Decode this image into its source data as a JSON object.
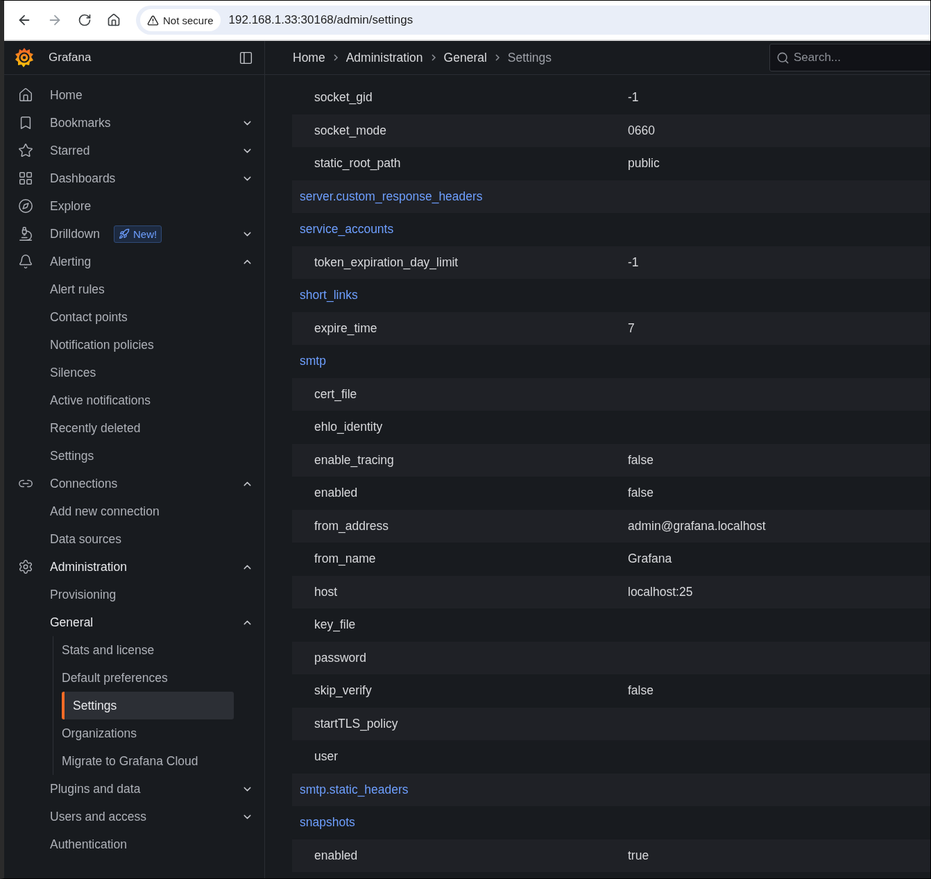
{
  "browser": {
    "security": "Not secure",
    "url": "192.168.1.33:30168/admin/settings"
  },
  "brand": "Grafana",
  "breadcrumbs": [
    "Home",
    "Administration",
    "General",
    "Settings"
  ],
  "search": {
    "placeholder": "Search..."
  },
  "sidebar": {
    "items": [
      {
        "label": "Home",
        "selected": false
      },
      {
        "label": "Bookmarks",
        "selected": false,
        "expanded": false
      },
      {
        "label": "Starred",
        "selected": false,
        "expanded": false
      },
      {
        "label": "Dashboards",
        "selected": false,
        "expanded": false
      },
      {
        "label": "Explore",
        "selected": false
      },
      {
        "label": "Drilldown",
        "selected": false,
        "expanded": false,
        "badge": "New!"
      },
      {
        "label": "Alerting",
        "selected": false,
        "expanded": true,
        "children": [
          {
            "label": "Alert rules",
            "selected": false
          },
          {
            "label": "Contact points",
            "selected": false
          },
          {
            "label": "Notification policies",
            "selected": false
          },
          {
            "label": "Silences",
            "selected": false
          },
          {
            "label": "Active notifications",
            "selected": false
          },
          {
            "label": "Recently deleted",
            "selected": false
          },
          {
            "label": "Settings",
            "selected": false
          }
        ]
      },
      {
        "label": "Connections",
        "selected": false,
        "expanded": true,
        "children": [
          {
            "label": "Add new connection",
            "selected": false
          },
          {
            "label": "Data sources",
            "selected": false
          }
        ]
      },
      {
        "label": "Administration",
        "selected": false,
        "expanded": true,
        "children": [
          {
            "label": "Provisioning",
            "selected": false
          },
          {
            "label": "General",
            "selected": false,
            "expanded": true,
            "children": [
              {
                "label": "Stats and license",
                "selected": false
              },
              {
                "label": "Default preferences",
                "selected": false
              },
              {
                "label": "Settings",
                "selected": true
              },
              {
                "label": "Organizations",
                "selected": false
              },
              {
                "label": "Migrate to Grafana Cloud",
                "selected": false
              }
            ]
          },
          {
            "label": "Plugins and data",
            "selected": false,
            "expanded": false
          },
          {
            "label": "Users and access",
            "selected": false,
            "expanded": false
          },
          {
            "label": "Authentication",
            "selected": false
          }
        ]
      }
    ]
  },
  "settings": {
    "rows": [
      {
        "kind": "setting",
        "name": "socket_gid",
        "value": "-1"
      },
      {
        "kind": "setting",
        "name": "socket_mode",
        "value": "0660"
      },
      {
        "kind": "setting",
        "name": "static_root_path",
        "value": "public"
      },
      {
        "kind": "section",
        "name": "server.custom_response_headers"
      },
      {
        "kind": "section",
        "name": "service_accounts"
      },
      {
        "kind": "setting",
        "name": "token_expiration_day_limit",
        "value": "-1"
      },
      {
        "kind": "section",
        "name": "short_links"
      },
      {
        "kind": "setting",
        "name": "expire_time",
        "value": "7"
      },
      {
        "kind": "section",
        "name": "smtp"
      },
      {
        "kind": "setting",
        "name": "cert_file"
      },
      {
        "kind": "setting",
        "name": "ehlo_identity"
      },
      {
        "kind": "setting",
        "name": "enable_tracing",
        "value": "false"
      },
      {
        "kind": "setting",
        "name": "enabled",
        "value": "false"
      },
      {
        "kind": "setting",
        "name": "from_address",
        "value": "admin@grafana.localhost"
      },
      {
        "kind": "setting",
        "name": "from_name",
        "value": "Grafana"
      },
      {
        "kind": "setting",
        "name": "host",
        "value": "localhost:25"
      },
      {
        "kind": "setting",
        "name": "key_file"
      },
      {
        "kind": "setting",
        "name": "password"
      },
      {
        "kind": "setting",
        "name": "skip_verify",
        "value": "false"
      },
      {
        "kind": "setting",
        "name": "startTLS_policy"
      },
      {
        "kind": "setting",
        "name": "user"
      },
      {
        "kind": "section",
        "name": "smtp.static_headers"
      },
      {
        "kind": "section",
        "name": "snapshots"
      },
      {
        "kind": "setting",
        "name": "enabled",
        "value": "true"
      }
    ]
  }
}
